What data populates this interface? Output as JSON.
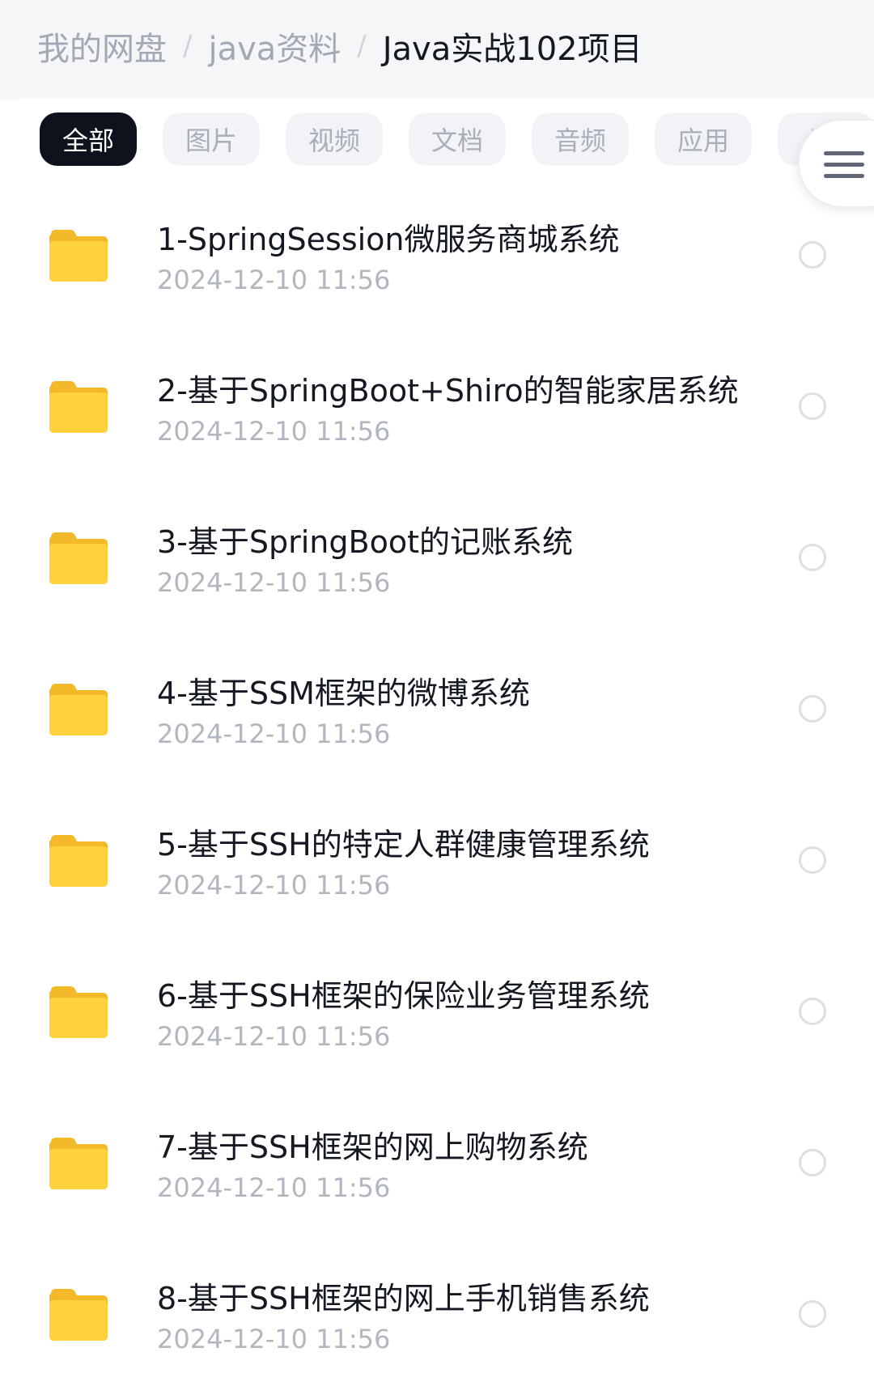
{
  "breadcrumb": {
    "root": "我的网盘",
    "parent": "java资料",
    "current": "Java实战102项目",
    "separator": "/"
  },
  "tabs": [
    "全部",
    "图片",
    "视频",
    "文档",
    "音频",
    "应用",
    "BT"
  ],
  "active_tab": "全部",
  "files": [
    {
      "name": "1-SpringSession微服务商城系统",
      "date": "2024-12-10  11:56"
    },
    {
      "name": "2-基于SpringBoot+Shiro的智能家居系统",
      "date": "2024-12-10  11:56"
    },
    {
      "name": "3-基于SpringBoot的记账系统",
      "date": "2024-12-10  11:56"
    },
    {
      "name": "4-基于SSM框架的微博系统",
      "date": "2024-12-10  11:56"
    },
    {
      "name": "5-基于SSH的特定人群健康管理系统",
      "date": "2024-12-10  11:56"
    },
    {
      "name": "6-基于SSH框架的保险业务管理系统",
      "date": "2024-12-10  11:56"
    },
    {
      "name": "7-基于SSH框架的网上购物系统",
      "date": "2024-12-10  11:56"
    },
    {
      "name": "8-基于SSH框架的网上手机销售系统",
      "date": "2024-12-10  11:56"
    }
  ],
  "icons": {
    "folder": "folder-icon",
    "menu": "menu-icon",
    "select": "radio-circle"
  },
  "colors": {
    "folder": "#ffd13d",
    "active_tab_bg": "#0d121c",
    "text_primary": "#141821",
    "text_muted": "#b2b6bf"
  }
}
